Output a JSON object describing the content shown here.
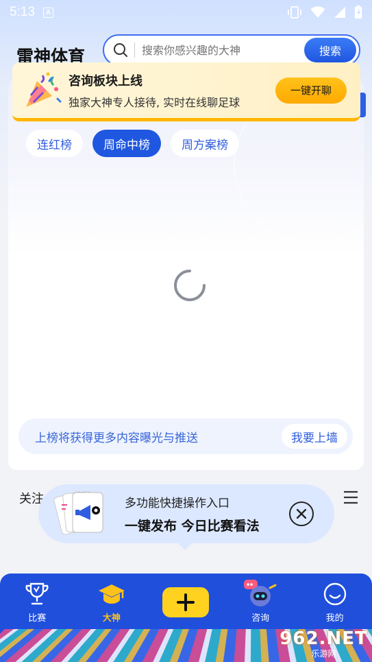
{
  "status_bar": {
    "time": "5:13",
    "a_icon": "A"
  },
  "header": {
    "app_title": "雷神体育",
    "search_placeholder": "搜索你感兴趣的大神",
    "search_button": "搜索"
  },
  "banner": {
    "title": "咨询板块上线",
    "subtitle": "独家大神专人接待, 实时在线聊足球",
    "button": "一键开聊"
  },
  "tabs": [
    {
      "label": "连红榜",
      "active": false
    },
    {
      "label": "周命中榜",
      "active": true
    },
    {
      "label": "周方案榜",
      "active": false
    }
  ],
  "promo": {
    "text": "上榜将获得更多内容曝光与推送",
    "button": "我要上墙"
  },
  "follow": {
    "label": "关注"
  },
  "tooltip": {
    "line1": "多功能快捷操作入口",
    "line2": "一键发布 今日比赛看法"
  },
  "bottom_nav": [
    {
      "label": "比赛",
      "icon": "trophy-icon"
    },
    {
      "label": "大神",
      "icon": "graduation-cap-icon",
      "active": true
    },
    {
      "label": "",
      "icon": "plus-icon"
    },
    {
      "label": "咨询",
      "icon": "robot-chat-icon"
    },
    {
      "label": "我的",
      "icon": "smile-icon"
    }
  ],
  "watermark": {
    "main": "962.NET",
    "sub": "乐游网"
  },
  "colors": {
    "primary_blue": "#1f57e0",
    "accent_yellow": "#ffc21a",
    "banner_bg": "#fff4d2"
  }
}
